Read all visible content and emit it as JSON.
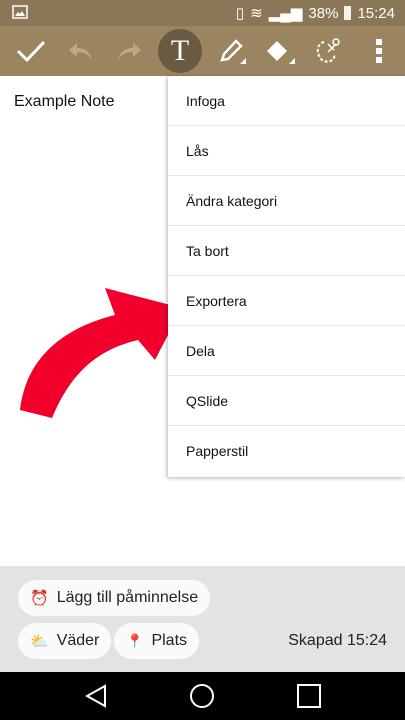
{
  "status": {
    "battery": "38%",
    "time": "15:24"
  },
  "toolbar": {
    "buttons": [
      "check-icon",
      "undo-icon",
      "redo-icon",
      "text-icon",
      "pen-icon",
      "eraser-icon",
      "lasso-cut-icon",
      "more-icon"
    ]
  },
  "note": {
    "title": "Example Note"
  },
  "menu": {
    "items": [
      "Infoga",
      "Lås",
      "Ändra kategori",
      "Ta bort",
      "Exportera",
      "Dela",
      "QSlide",
      "Papperstil"
    ]
  },
  "bottom": {
    "reminder": "Lägg till påminnelse",
    "weather": "Väder",
    "location": "Plats",
    "created": "Skapad 15:24"
  },
  "colors": {
    "toolbar": "#9b8561",
    "arrow": "#f0002a"
  }
}
